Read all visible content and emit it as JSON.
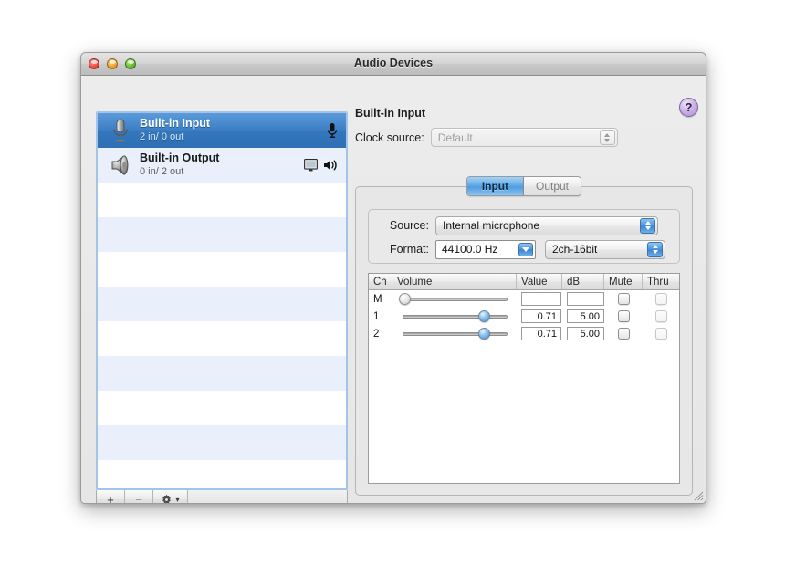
{
  "window": {
    "title": "Audio Devices",
    "controls": {
      "close": "close",
      "minimize": "minimize",
      "zoom": "zoom"
    }
  },
  "device_list": {
    "devices": [
      {
        "name": "Built-in Input",
        "channels": "2 in/ 0 out",
        "icon": "microphone-icon",
        "selected": true,
        "badges": [
          "microphone-icon"
        ]
      },
      {
        "name": "Built-in Output",
        "channels": "0 in/ 2 out",
        "icon": "speaker-icon",
        "selected": false,
        "badges": [
          "display-icon",
          "speaker-icon"
        ]
      }
    ],
    "empty_rows": 9,
    "toolbar": {
      "add_label": "+",
      "remove_label": "−",
      "action_label": "gear-icon",
      "action_arrow": "▾"
    }
  },
  "detail": {
    "title": "Built-in Input",
    "clock_source_label": "Clock source:",
    "clock_source_value": "Default",
    "help_label": "?",
    "tabs": [
      {
        "label": "Input",
        "active": true
      },
      {
        "label": "Output",
        "active": false
      }
    ],
    "source_label": "Source:",
    "source_value": "Internal microphone",
    "format_label": "Format:",
    "format_rate": "44100.0 Hz",
    "format_bits": "2ch-16bit",
    "table": {
      "columns": [
        "Ch",
        "Volume",
        "Value",
        "dB",
        "Mute",
        "Thru"
      ],
      "rows": [
        {
          "ch": "M",
          "volume": 0,
          "knob_enabled": false,
          "value": "",
          "db": "",
          "mute": false,
          "mute_enabled": true,
          "thru": false,
          "thru_enabled": false
        },
        {
          "ch": "1",
          "volume": 0.71,
          "knob_enabled": true,
          "value": "0.71",
          "db": "5.00",
          "mute": false,
          "mute_enabled": true,
          "thru": false,
          "thru_enabled": false
        },
        {
          "ch": "2",
          "volume": 0.71,
          "knob_enabled": true,
          "value": "0.71",
          "db": "5.00",
          "mute": false,
          "mute_enabled": true,
          "thru": false,
          "thru_enabled": false
        }
      ]
    }
  },
  "colors": {
    "selection_blue": "#3d7fc4",
    "stripe_blue": "#e9f0fb",
    "window_bg": "#ebebeb",
    "help_purple": "#a98ed0"
  }
}
